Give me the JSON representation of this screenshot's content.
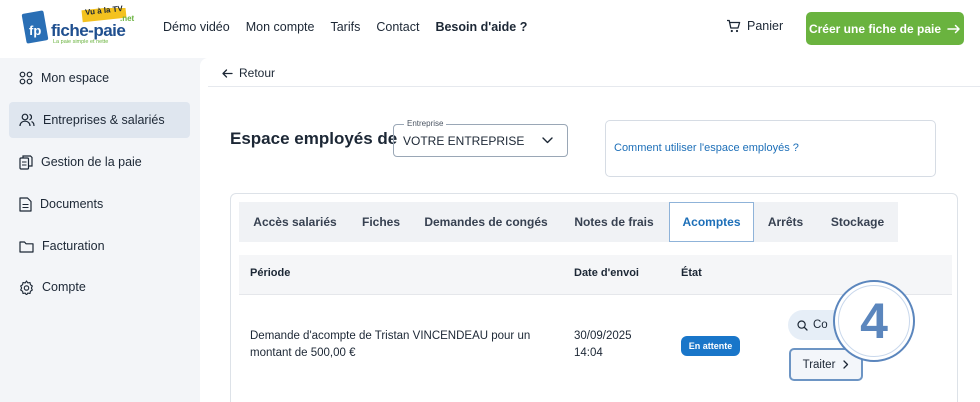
{
  "header": {
    "logo": {
      "brand": "fiche-paie",
      "badge": "Vu à la TV",
      "suffix": ".net",
      "tagline": "La paie simple et nette"
    },
    "nav": [
      "Démo vidéo",
      "Mon compte",
      "Tarifs",
      "Contact",
      "Besoin d'aide ?"
    ],
    "cart_label": "Panier",
    "cta_label": "Créer une fiche de paie",
    "cta_color": "#6ab33f"
  },
  "sidebar": {
    "items": [
      {
        "label": "Mon espace",
        "icon": "grid-icon"
      },
      {
        "label": "Entreprises & salariés",
        "icon": "users-icon",
        "active": true
      },
      {
        "label": "Gestion de la paie",
        "icon": "documents-icon"
      },
      {
        "label": "Documents",
        "icon": "document-icon"
      },
      {
        "label": "Facturation",
        "icon": "folder-icon"
      },
      {
        "label": "Compte",
        "icon": "gear-icon"
      }
    ]
  },
  "main": {
    "back_label": "Retour",
    "title": "Espace employés de",
    "company_select": {
      "label": "Entreprise",
      "value": "VOTRE ENTREPRISE"
    },
    "help_link": "Comment utiliser l'espace employés ?",
    "tabs": [
      "Accès salariés",
      "Fiches",
      "Demandes de congés",
      "Notes de frais",
      "Acomptes",
      "Arrêts",
      "Stockage"
    ],
    "active_tab": "Acomptes",
    "table": {
      "headers": [
        "Période",
        "Date d'envoi",
        "État"
      ],
      "rows": [
        {
          "period_line1": "Demande d'acompte de Tristan VINCENDEAU pour un",
          "period_line2": "montant de 500,00 €",
          "date_line1": "30/09/2025",
          "date_line2": "14:04",
          "status": "En attente",
          "consult_label": "Co",
          "action_label": "Traiter"
        }
      ]
    },
    "step_number": "4",
    "accent_color": "#1d6fb8"
  }
}
